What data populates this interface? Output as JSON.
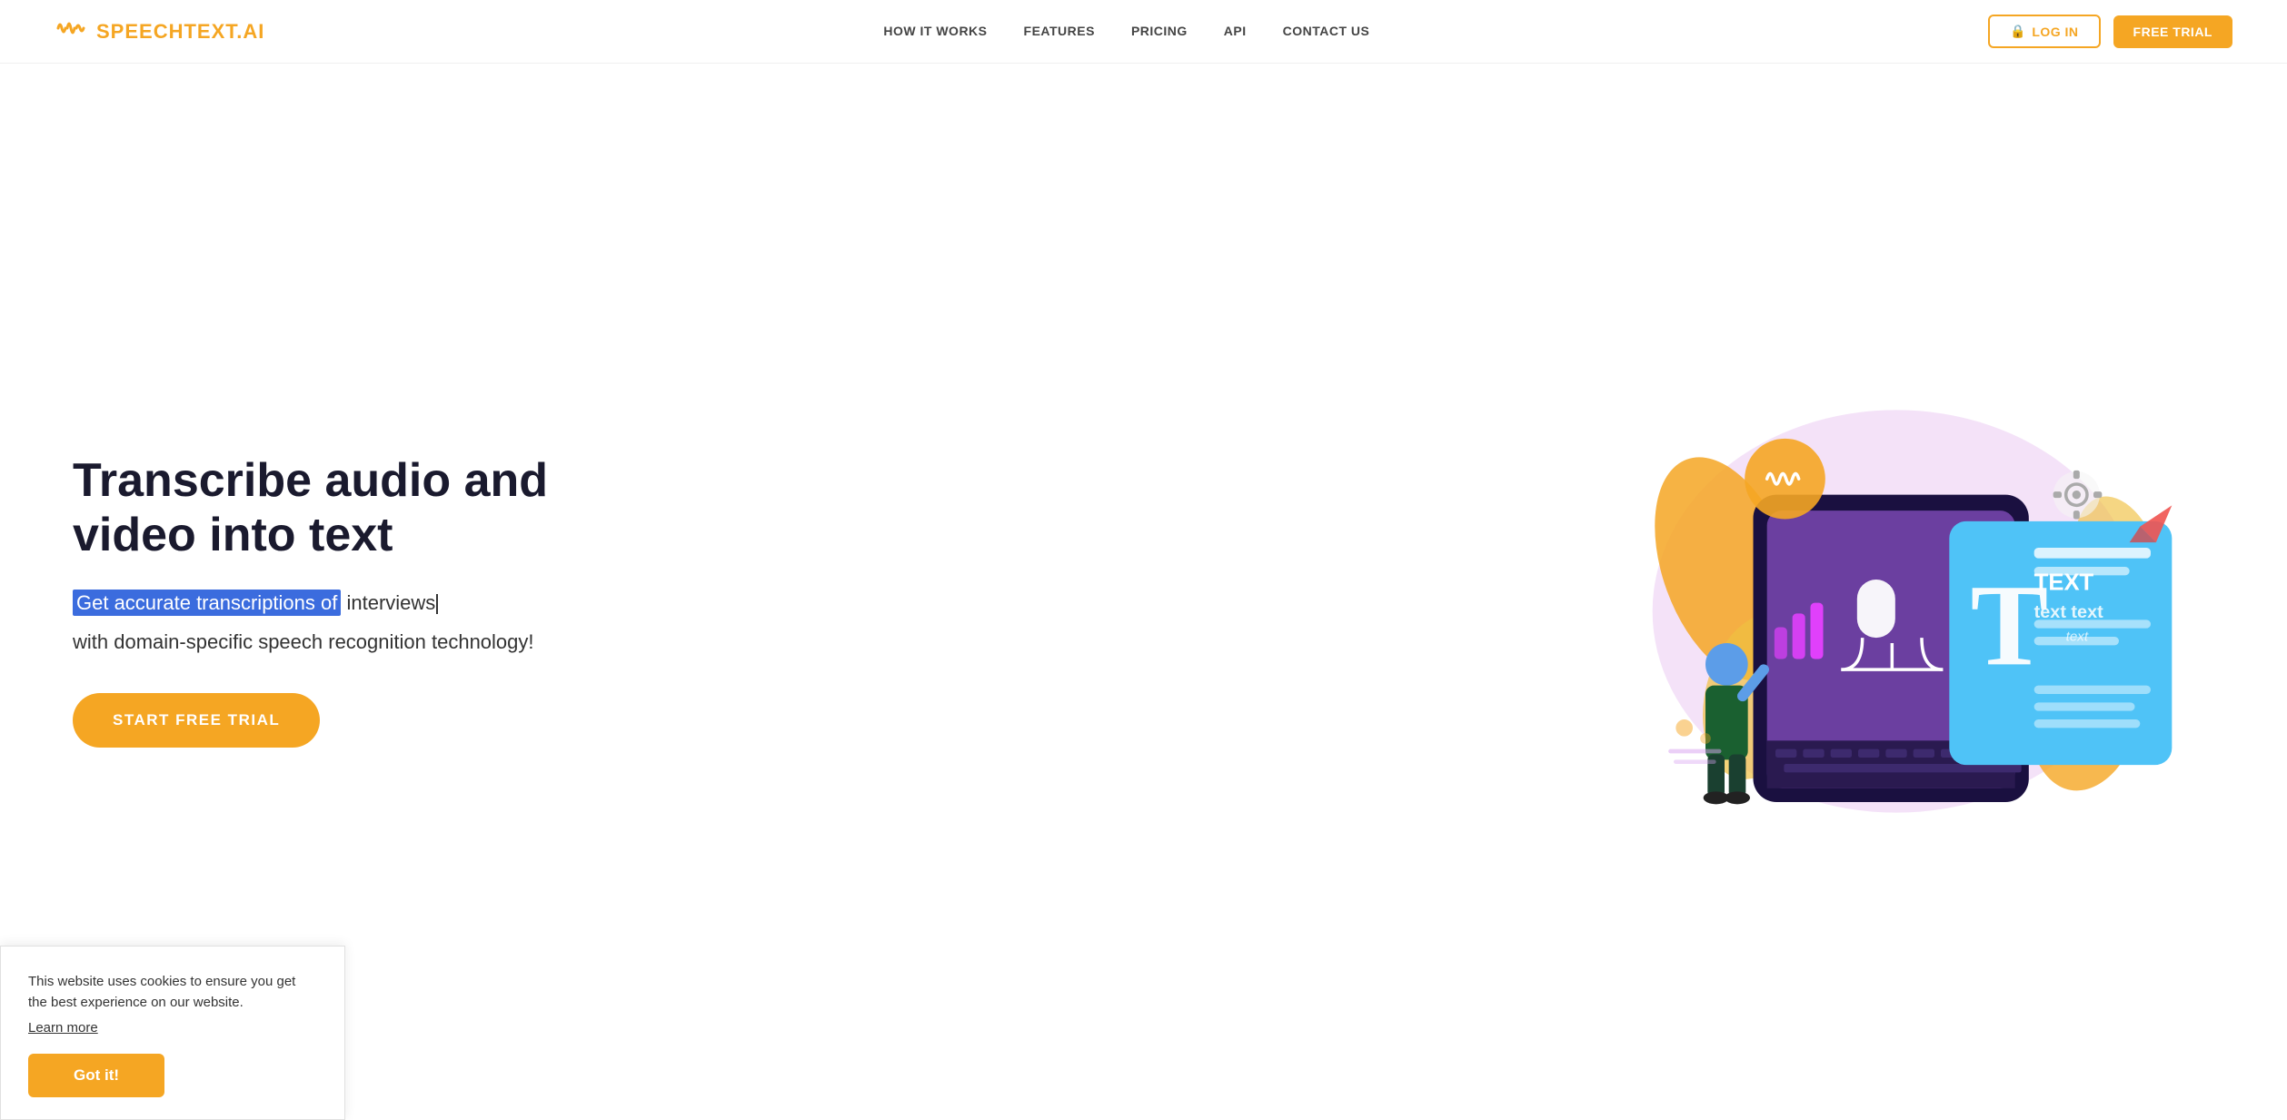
{
  "nav": {
    "logo_waves": "»)",
    "logo_brand": "SPEECHTEXT",
    "logo_domain": ".AI",
    "links": [
      {
        "id": "how-it-works",
        "label": "HOW IT WORKS"
      },
      {
        "id": "features",
        "label": "FEATURES"
      },
      {
        "id": "pricing",
        "label": "PRICING"
      },
      {
        "id": "api",
        "label": "API"
      },
      {
        "id": "contact-us",
        "label": "CONTACT US"
      }
    ],
    "login_label": "LOG IN",
    "login_icon": "🔒",
    "free_trial_label": "FREE TRIAL"
  },
  "hero": {
    "title": "Transcribe audio and video into text",
    "subtitle_highlighted": "Get accurate transcriptions of",
    "subtitle_typed": "interviews",
    "subtitle_rest": "with domain-specific speech recognition technology!",
    "cta_label": "START FREE TRIAL"
  },
  "cookie": {
    "text": "This website uses cookies to ensure you get the best experience on our website.",
    "learn_more_label": "Learn more",
    "got_it_label": "Got it!"
  },
  "colors": {
    "gold": "#f5a623",
    "navy": "#1a1a2e",
    "blue_highlight": "#3b6cde"
  }
}
